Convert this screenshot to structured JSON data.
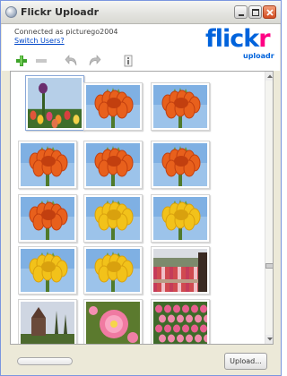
{
  "window": {
    "title": "Flickr Uploadr"
  },
  "header": {
    "connected_text": "Connected as picturego2004",
    "switch_users": "Switch Users?",
    "logo_part1": "flick",
    "logo_part2": "r",
    "logo_sub": "uploadr"
  },
  "toolbar": {
    "icons": [
      "add-icon",
      "remove-icon",
      "rotate-left-icon",
      "rotate-right-icon",
      "info-icon"
    ]
  },
  "photos": [
    {
      "kind": "tulips",
      "selected": true
    },
    {
      "kind": "orange"
    },
    {
      "kind": "orange"
    },
    {
      "kind": "orange"
    },
    {
      "kind": "orange"
    },
    {
      "kind": "orange"
    },
    {
      "kind": "orange"
    },
    {
      "kind": "yellow"
    },
    {
      "kind": "yellow"
    },
    {
      "kind": "yellow"
    },
    {
      "kind": "yellow"
    },
    {
      "kind": "garden"
    },
    {
      "kind": "church"
    },
    {
      "kind": "pink"
    },
    {
      "kind": "pinkfield"
    }
  ],
  "footer": {
    "upload_label": "Upload..."
  },
  "colors": {
    "flickr_blue": "#0063dc",
    "flickr_pink": "#ff0084"
  }
}
